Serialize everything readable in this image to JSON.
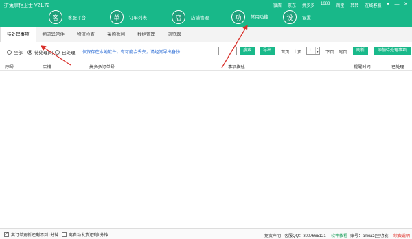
{
  "window": {
    "title": "拼兔掌柜卫士 V21.72",
    "top_links": [
      "微店",
      "京东",
      "拼多多",
      "1688",
      "淘宝",
      "转转"
    ],
    "online_service": "在线客服",
    "controls": [
      "▾",
      "—",
      "✕"
    ]
  },
  "nav": [
    {
      "icon_char": "客",
      "label": "客服平台"
    },
    {
      "icon_char": "单",
      "label": "订单列表"
    },
    {
      "icon_char": "店",
      "label": "店铺管理"
    },
    {
      "icon_char": "功",
      "label": "常用功能"
    },
    {
      "icon_char": "设",
      "label": "设置"
    }
  ],
  "tabs": [
    "待处理事项",
    "物流异常件",
    "物流检查",
    "采购盈利",
    "数据管理",
    "浏览器"
  ],
  "filters": {
    "options": [
      "全部",
      "待处理(0)",
      "已处理"
    ],
    "note": "仅保存在本地软件，有可能会丢失，请经常导出备份"
  },
  "toolbar": {
    "search": "搜索",
    "export": "导出",
    "first_page": "首页",
    "prev_page": "上页",
    "page_value": "1",
    "next_page": "下页",
    "last_page": "尾页",
    "refresh": "刷新",
    "add": "添加待处理事项"
  },
  "table": {
    "columns": [
      "序号",
      "店铺",
      "拼多多订单号",
      "事项描述",
      "提醒时间",
      "已处理"
    ]
  },
  "statusbar": {
    "check1": "离订单更新还剩不到1分钟",
    "check2": "离自动发货还剩1分钟",
    "disclaimer": "免责声明",
    "qq": "客服QQ：3007665121",
    "tutorial": "软件教程",
    "account": "账号：anxiaz(全功能)",
    "renew": "续费说明"
  },
  "colors": {
    "brand": "#18b889",
    "link_blue": "#2f6fd6",
    "tutorial_green": "#1a9e5a",
    "renew_red": "#e0322b",
    "arrow_red": "#d9302a"
  }
}
